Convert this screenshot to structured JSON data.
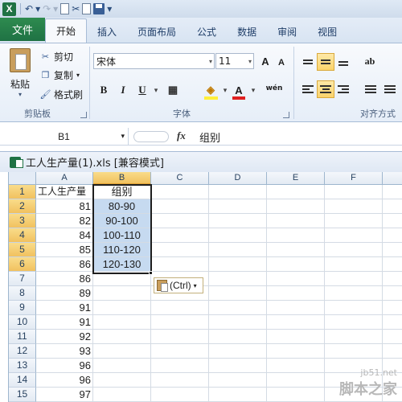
{
  "app": {
    "accent_file_tab": "#1f7244",
    "selection_fill": "#c6daf0",
    "header_highlight": "#f1c15f"
  },
  "qat": {
    "logo": "X",
    "undo_icon": "↶",
    "redo_icon": "↷",
    "dropdown_icon": "▾"
  },
  "tabs": {
    "file": "文件",
    "items": [
      "开始",
      "插入",
      "页面布局",
      "公式",
      "数据",
      "审阅",
      "视图"
    ],
    "active_index": 0
  },
  "ribbon": {
    "clipboard": {
      "paste": "粘贴",
      "cut": "剪切",
      "copy": "复制",
      "format_painter": "格式刷",
      "group_label": "剪贴板"
    },
    "font": {
      "font_name": "宋体",
      "font_size": "11",
      "grow": "A",
      "shrink": "A",
      "bold": "B",
      "italic": "I",
      "underline": "U",
      "phonetic": "wén",
      "group_label": "字体"
    },
    "alignment": {
      "group_label": "对齐方式"
    }
  },
  "formula_bar": {
    "name_box": "B1",
    "fx": "fx",
    "content": "组别"
  },
  "workbook": {
    "title": "工人生产量(1).xls  [兼容模式]"
  },
  "sheet": {
    "columns": [
      "A",
      "B",
      "C",
      "D",
      "E",
      "F"
    ],
    "selected_column": "B",
    "rows": [
      {
        "n": "1",
        "a": "工人生产量",
        "b": "组别"
      },
      {
        "n": "2",
        "a": "81",
        "b": "80-90"
      },
      {
        "n": "3",
        "a": "82",
        "b": "90-100"
      },
      {
        "n": "4",
        "a": "84",
        "b": "100-110"
      },
      {
        "n": "5",
        "a": "85",
        "b": "110-120"
      },
      {
        "n": "6",
        "a": "86",
        "b": "120-130"
      },
      {
        "n": "7",
        "a": "86",
        "b": ""
      },
      {
        "n": "8",
        "a": "89",
        "b": ""
      },
      {
        "n": "9",
        "a": "91",
        "b": ""
      },
      {
        "n": "10",
        "a": "91",
        "b": ""
      },
      {
        "n": "11",
        "a": "92",
        "b": ""
      },
      {
        "n": "12",
        "a": "93",
        "b": ""
      },
      {
        "n": "13",
        "a": "96",
        "b": ""
      },
      {
        "n": "14",
        "a": "96",
        "b": ""
      },
      {
        "n": "15",
        "a": "97",
        "b": ""
      }
    ]
  },
  "paste_options": {
    "label": "(Ctrl)"
  },
  "watermark": {
    "site": "jb51.net",
    "name": "脚本之家"
  }
}
